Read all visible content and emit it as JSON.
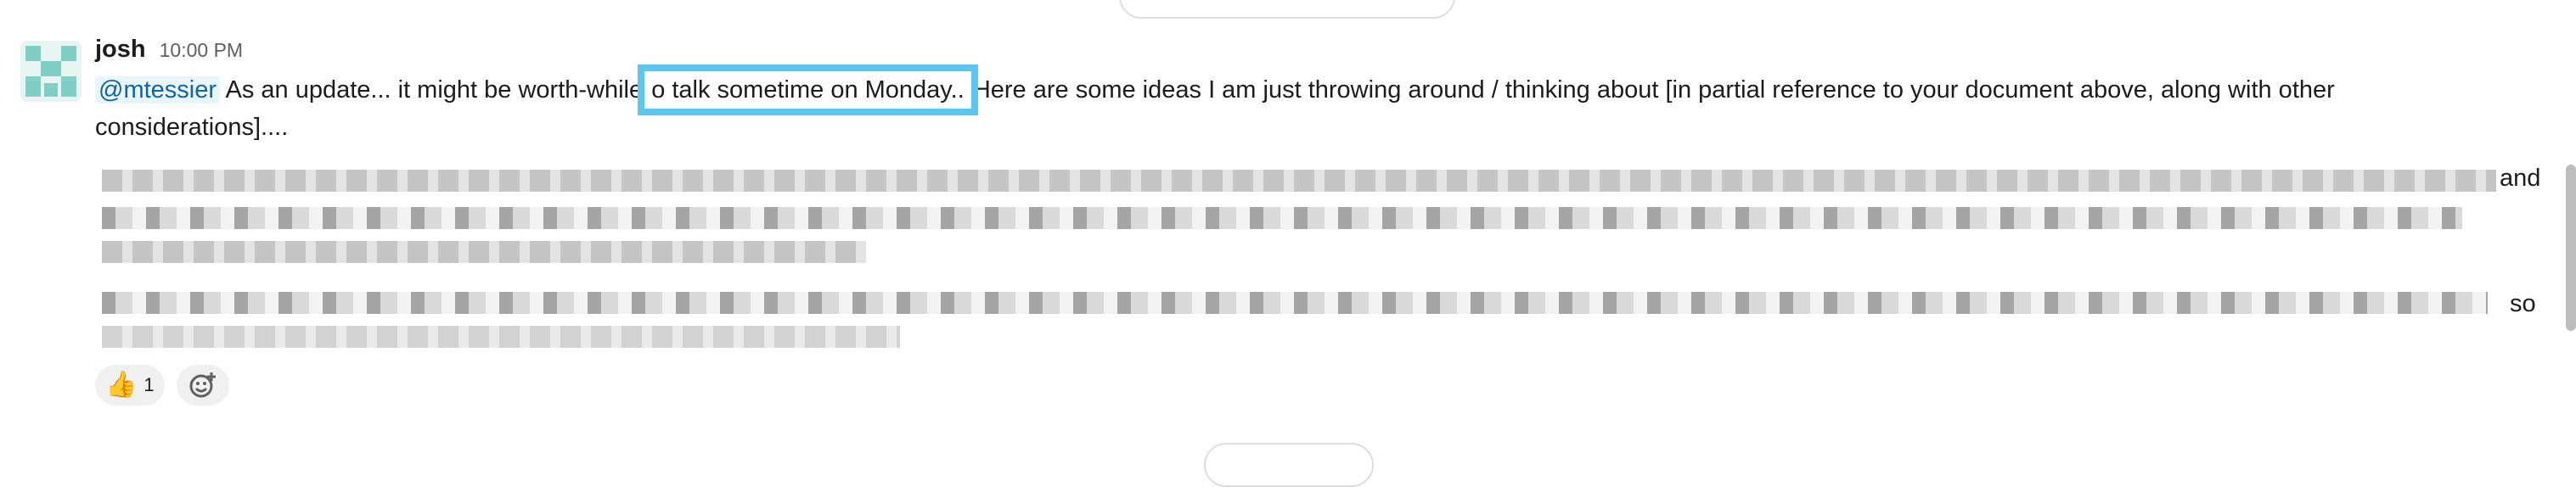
{
  "message": {
    "author": "josh",
    "time": "10:00 PM",
    "mention": "@mtessier",
    "text_before": "As an update... it might be worth-while ",
    "highlighted": "o talk sometime on Monday..",
    "text_after": " Here are some ideas I am just throwing around / thinking about [in partial reference to your document above, along with other considerations]...."
  },
  "redacted": {
    "line1_tail": "and",
    "line4_tail": "so"
  },
  "reactions": [
    {
      "emoji": "👍",
      "count": "1"
    }
  ],
  "colors": {
    "highlight_border": "#5bc7ec",
    "mention_text": "#1264a3",
    "avatar_teal": "#7fcfc6"
  }
}
